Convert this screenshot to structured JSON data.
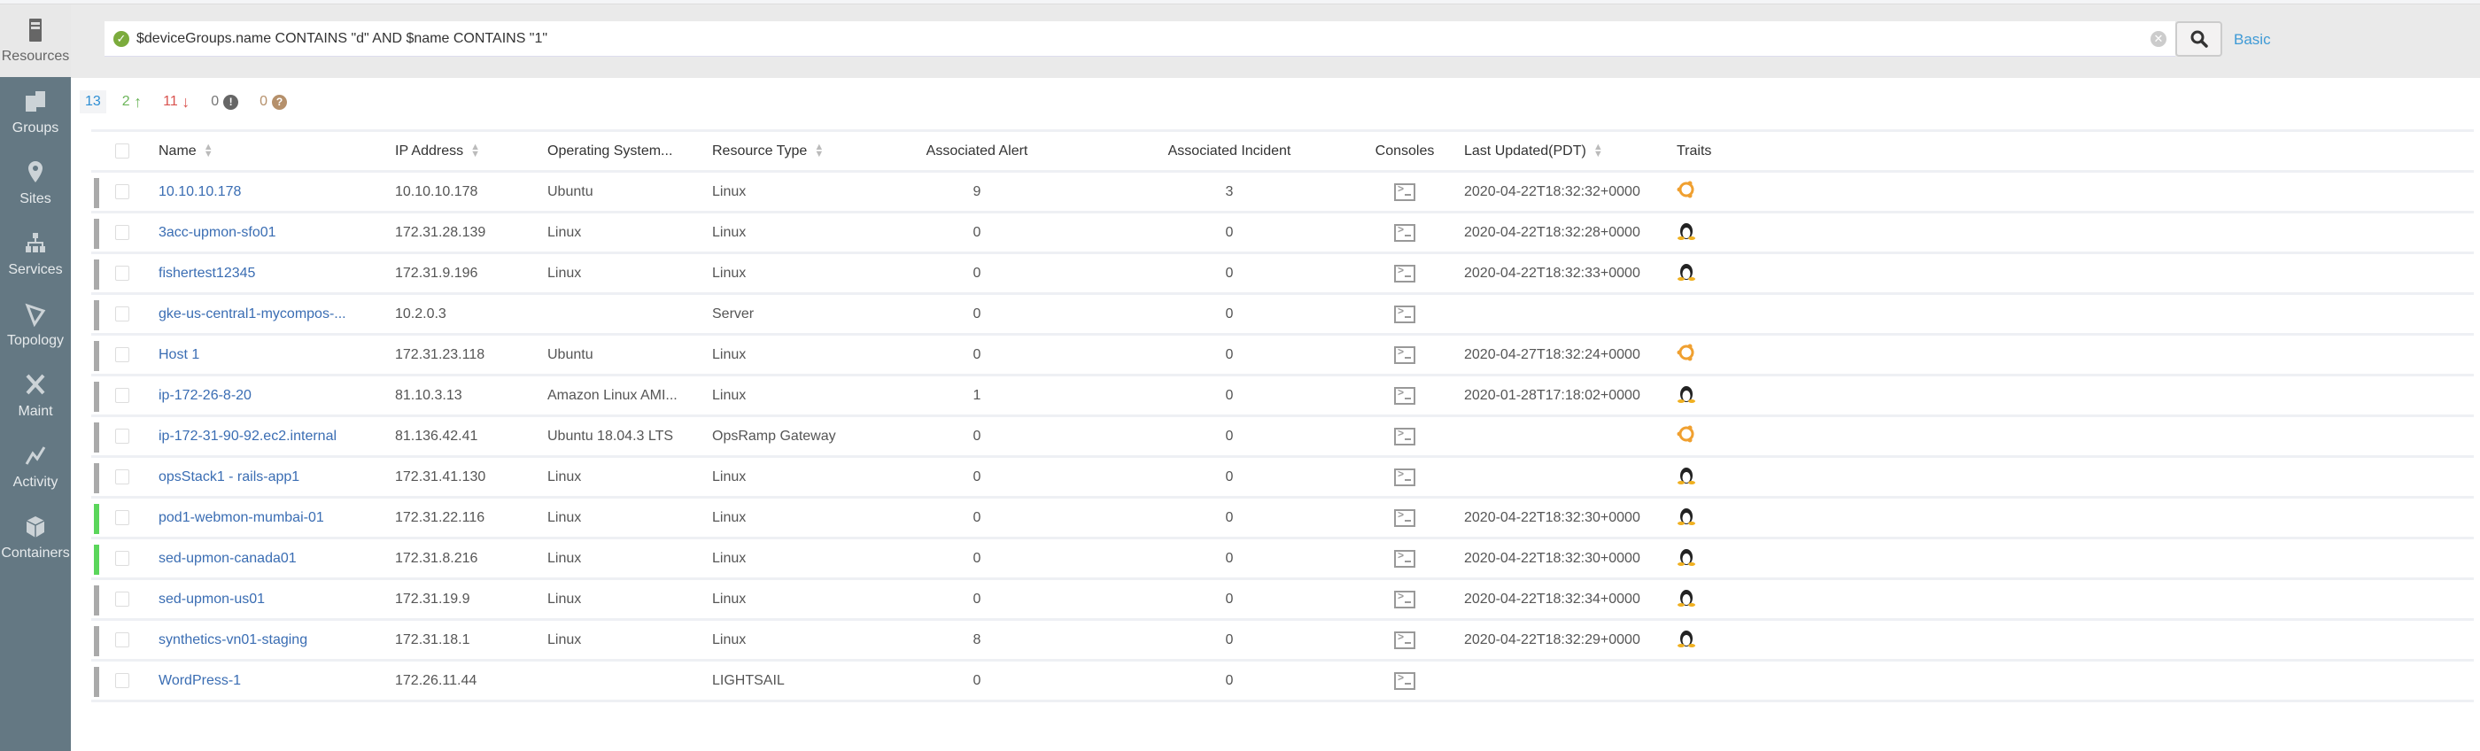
{
  "sidebar": {
    "items": [
      {
        "label": "Resources",
        "icon": "server-icon",
        "active": true
      },
      {
        "label": "Groups",
        "icon": "groups-icon"
      },
      {
        "label": "Sites",
        "icon": "map-pin-icon"
      },
      {
        "label": "Services",
        "icon": "hierarchy-icon"
      },
      {
        "label": "Topology",
        "icon": "topology-icon"
      },
      {
        "label": "Maint",
        "icon": "tools-icon"
      },
      {
        "label": "Activity",
        "icon": "activity-icon"
      },
      {
        "label": "Containers",
        "icon": "cube-icon"
      }
    ]
  },
  "search": {
    "query": "$deviceGroups.name CONTAINS \"d\" AND $name CONTAINS \"1\"",
    "mode_link": "Basic"
  },
  "counts": {
    "total": "13",
    "up": "2",
    "down": "11",
    "critical": "0",
    "unknown": "0"
  },
  "colors": {
    "accent": "#3e9ad6",
    "up": "#6cb55a",
    "down": "#d9534f",
    "unknown": "#b5906b",
    "sidebar": "#647883"
  },
  "table": {
    "columns": [
      "Name",
      "IP Address",
      "Operating System...",
      "Resource Type",
      "Associated Alert",
      "Associated Incident",
      "Consoles",
      "Last Updated(PDT)",
      "Traits"
    ],
    "rows": [
      {
        "status": "down",
        "name": "10.10.10.178",
        "ip": "10.10.10.178",
        "os": "Ubuntu",
        "type": "Linux",
        "alert": "9",
        "incident": "3",
        "updated": "2020-04-22T18:32:32+0000",
        "trait": "ubuntu"
      },
      {
        "status": "down",
        "name": "3acc-upmon-sfo01",
        "ip": "172.31.28.139",
        "os": "Linux",
        "type": "Linux",
        "alert": "0",
        "incident": "0",
        "updated": "2020-04-22T18:32:28+0000",
        "trait": "linux"
      },
      {
        "status": "down",
        "name": "fishertest12345",
        "ip": "172.31.9.196",
        "os": "Linux",
        "type": "Linux",
        "alert": "0",
        "incident": "0",
        "updated": "2020-04-22T18:32:33+0000",
        "trait": "linux"
      },
      {
        "status": "down",
        "name": "gke-us-central1-mycompos-...",
        "ip": "10.2.0.3",
        "os": "",
        "type": "Server",
        "alert": "0",
        "incident": "0",
        "updated": "",
        "trait": ""
      },
      {
        "status": "down",
        "name": "Host 1",
        "ip": "172.31.23.118",
        "os": "Ubuntu",
        "type": "Linux",
        "alert": "0",
        "incident": "0",
        "updated": "2020-04-27T18:32:24+0000",
        "trait": "ubuntu"
      },
      {
        "status": "down",
        "name": "ip-172-26-8-20",
        "ip": "81.10.3.13",
        "os": "Amazon Linux AMI...",
        "type": "Linux",
        "alert": "1",
        "incident": "0",
        "updated": "2020-01-28T17:18:02+0000",
        "trait": "linux"
      },
      {
        "status": "down",
        "name": "ip-172-31-90-92.ec2.internal",
        "ip": "81.136.42.41",
        "os": "Ubuntu 18.04.3 LTS",
        "type": "OpsRamp Gateway",
        "alert": "0",
        "incident": "0",
        "updated": "",
        "trait": "ubuntu"
      },
      {
        "status": "down",
        "name": "opsStack1 - rails-app1",
        "ip": "172.31.41.130",
        "os": "Linux",
        "type": "Linux",
        "alert": "0",
        "incident": "0",
        "updated": "",
        "trait": "linux"
      },
      {
        "status": "up",
        "name": "pod1-webmon-mumbai-01",
        "ip": "172.31.22.116",
        "os": "Linux",
        "type": "Linux",
        "alert": "0",
        "incident": "0",
        "updated": "2020-04-22T18:32:30+0000",
        "trait": "linux"
      },
      {
        "status": "up",
        "name": "sed-upmon-canada01",
        "ip": "172.31.8.216",
        "os": "Linux",
        "type": "Linux",
        "alert": "0",
        "incident": "0",
        "updated": "2020-04-22T18:32:30+0000",
        "trait": "linux"
      },
      {
        "status": "down",
        "name": "sed-upmon-us01",
        "ip": "172.31.19.9",
        "os": "Linux",
        "type": "Linux",
        "alert": "0",
        "incident": "0",
        "updated": "2020-04-22T18:32:34+0000",
        "trait": "linux"
      },
      {
        "status": "down",
        "name": "synthetics-vn01-staging",
        "ip": "172.31.18.1",
        "os": "Linux",
        "type": "Linux",
        "alert": "8",
        "incident": "0",
        "updated": "2020-04-22T18:32:29+0000",
        "trait": "linux"
      },
      {
        "status": "down",
        "name": "WordPress-1",
        "ip": "172.26.11.44",
        "os": "",
        "type": "LIGHTSAIL",
        "alert": "0",
        "incident": "0",
        "updated": "",
        "trait": ""
      }
    ]
  }
}
